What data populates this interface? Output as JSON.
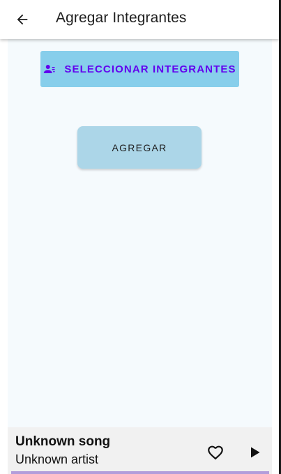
{
  "appbar": {
    "title": "Agregar Integrantes",
    "back_icon": "arrow-back-icon"
  },
  "main": {
    "select_button": {
      "label": "SELECCIONAR INTEGRANTES",
      "icon": "person-list-icon",
      "background": "#87ceeb",
      "text_color": "#6200ee"
    },
    "add_button": {
      "label": "AGREGAR",
      "background": "#acd6e8"
    }
  },
  "player": {
    "song": "Unknown song",
    "artist": "Unknown artist",
    "favorite_icon": "heart-outline-icon",
    "play_icon": "play-icon",
    "progress_color": "#b39ddb"
  }
}
